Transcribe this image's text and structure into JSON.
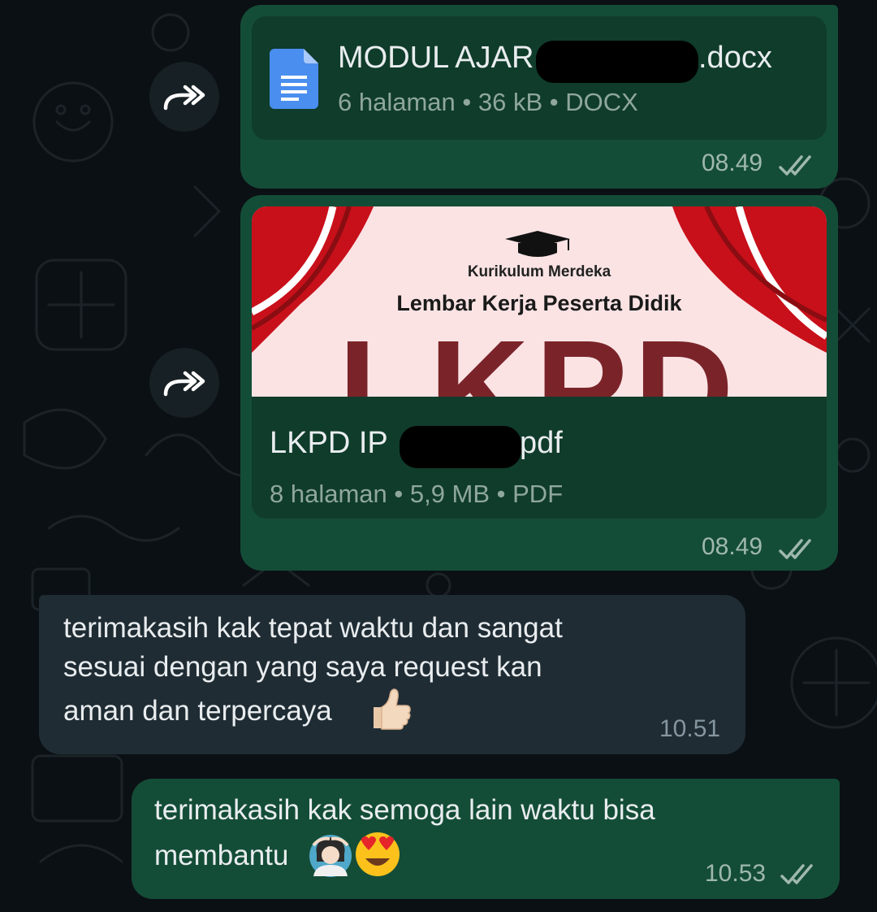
{
  "messages": [
    {
      "type": "document",
      "file_name_start": "MODUL AJAR",
      "file_name_end": ".docx",
      "meta": "6 halaman • 36 kB • DOCX",
      "time": "08.49",
      "icon": "google-docs-icon"
    },
    {
      "type": "document-preview",
      "preview": {
        "subtitle": "Kurikulum Merdeka",
        "title": "Lembar Kerja Peserta Didik",
        "big_text": "LKPD",
        "colors": {
          "bg": "#fbe3e4",
          "red": "#c8101a",
          "dark_red": "#7a2429"
        }
      },
      "file_name_start": "LKPD IP",
      "file_name_end": "pdf",
      "meta": "8 halaman • 5,9 MB • PDF",
      "time": "08.49"
    },
    {
      "type": "text-incoming",
      "lines": [
        "terimakasih kak tepat waktu dan sangat",
        "sesuai dengan yang saya request kan",
        "aman dan terpercaya"
      ],
      "emoji": "thumbs-up",
      "time": "10.51"
    },
    {
      "type": "text-outgoing",
      "lines": [
        "terimakasih kak semoga lain waktu bisa",
        "membantu"
      ],
      "emojis": [
        "woman-gesturing-ok",
        "heart-eyes"
      ],
      "time": "10.53"
    }
  ],
  "colors": {
    "outgoing_bubble": "#144d37",
    "incoming_bubble": "#1f2c34",
    "background": "#0b1014"
  }
}
